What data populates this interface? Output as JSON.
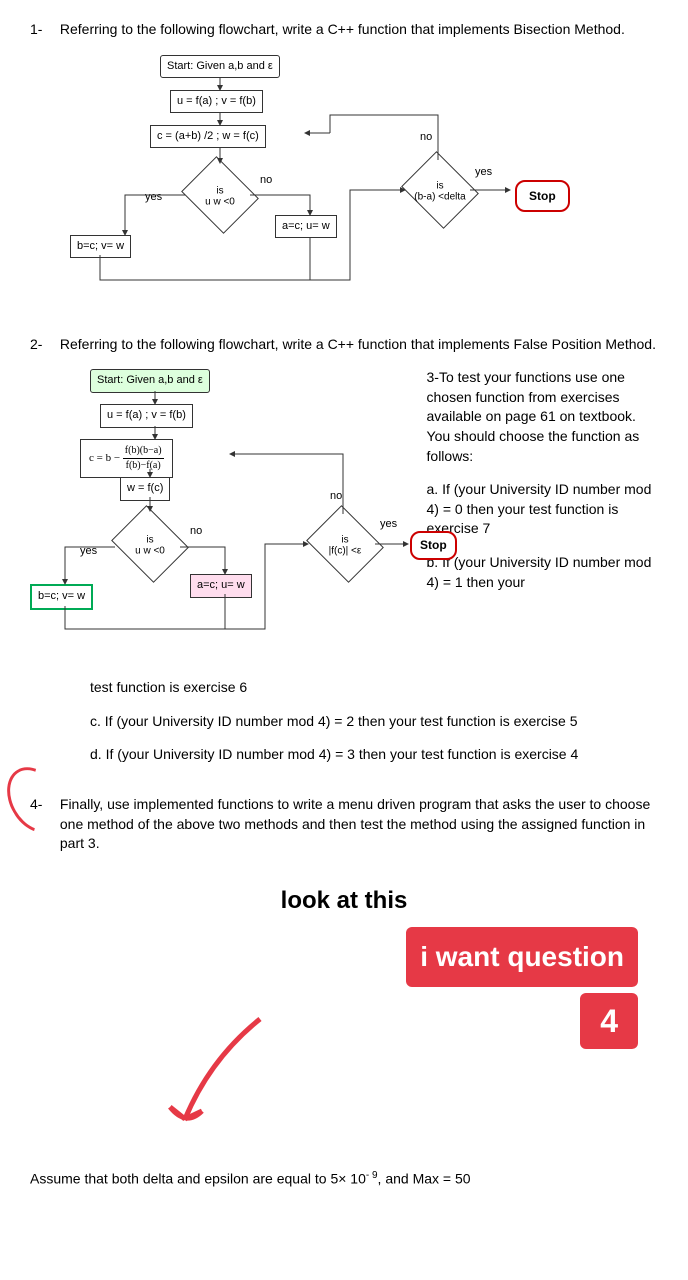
{
  "q1": {
    "num": "1-",
    "text": "Referring to the following flowchart, write a C++ function that implements Bisection Method.",
    "start": "Start: Given a,b and ε",
    "uv": "u = f(a) ; v = f(b)",
    "c": "c = (a+b) /2 ; w = f(c)",
    "dec1": "is\nu w <0",
    "yes": "yes",
    "no": "no",
    "bc": "b=c; v= w",
    "ac": "a=c; u= w",
    "dec2": "is\n(b-a) <delta",
    "stop": "Stop"
  },
  "q2": {
    "num": "2-",
    "text": "Referring to the following flowchart, write a C++ function that implements False Position Method.",
    "start": "Start: Given a,b and ε",
    "uv": "u = f(a) ; v = f(b)",
    "cformula_left": "c = b −",
    "cformula_top": "f(b)(b−a)",
    "cformula_bot": "f(b)−f(a)",
    "w": "w = f(c)",
    "dec1": "is\nu w <0",
    "yes": "yes",
    "no": "no",
    "bc": "b=c; v= w",
    "ac": "a=c; u= w",
    "dec2": "is\n|f(c)| <ε",
    "stop": "Stop"
  },
  "q3": {
    "intro": "3-To test your functions use one chosen function from exercises available on page 61 on textbook. You should choose the function as follows:",
    "a": "a. If (your University ID number mod 4) = 0 then your test function is exercise 7",
    "b": "b. If (your University ID number mod 4) = 1 then your",
    "bcont": "test function is exercise 6",
    "c": "c.   If (your University ID number mod 4) = 2 then your test function is exercise 5",
    "d": "d.   If (your University ID number mod 4) = 3 then your test function is exercise 4"
  },
  "q4": {
    "num": "4-",
    "text": "Finally, use implemented functions to write a menu driven program that asks the user to choose one method of the above two methods and then test the method using the assigned function in part 3."
  },
  "look": "look at this",
  "iwant1": "i want question",
  "iwant2": "4",
  "assume_pre": "Assume that both delta and epsilon are equal to ",
  "assume_exp": "5× 10",
  "assume_sup": "- 9",
  "assume_post": ", and Max = 50"
}
